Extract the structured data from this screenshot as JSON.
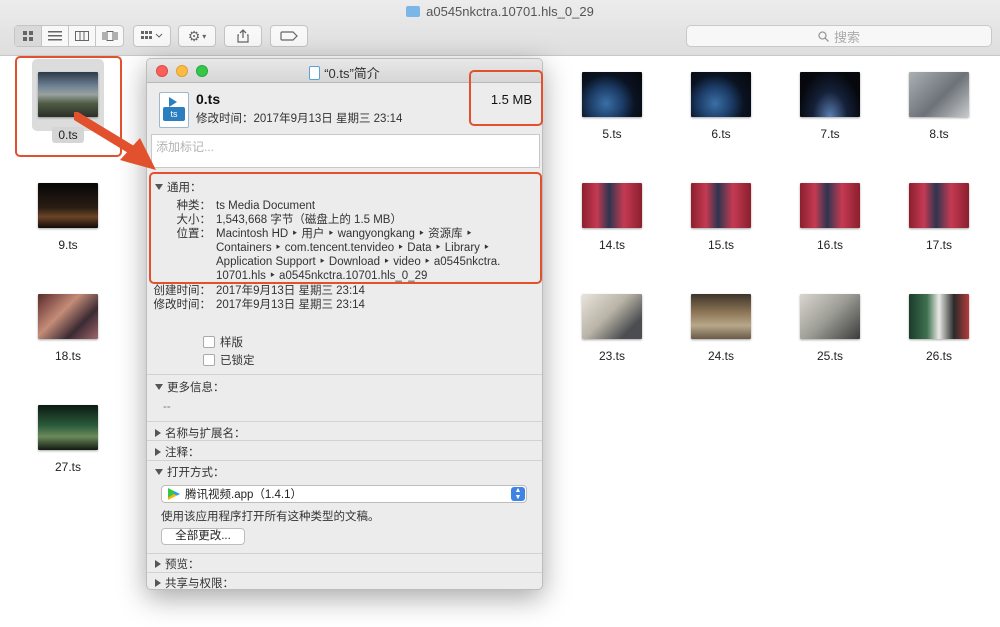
{
  "finder": {
    "window_title": "a0545nkctra.10701.hls_0_29",
    "search_placeholder": "搜索",
    "toolbar": {
      "view_icon": "icon-view-icon",
      "list_view": "list-view-icon",
      "column_view": "column-view-icon",
      "cover_flow": "cover-flow-icon",
      "group_icon": "group-icon",
      "action_icon": "gear-icon",
      "share_icon": "share-icon",
      "tag_icon": "tag-icon"
    },
    "files": [
      {
        "name": "0.ts",
        "thumb": "mountain"
      },
      {
        "name": "5.ts",
        "thumb": "earth"
      },
      {
        "name": "6.ts",
        "thumb": "earth"
      },
      {
        "name": "7.ts",
        "thumb": "space"
      },
      {
        "name": "8.ts",
        "thumb": "gray"
      },
      {
        "name": "9.ts",
        "thumb": "dark"
      },
      {
        "name": "14.ts",
        "thumb": "stage"
      },
      {
        "name": "15.ts",
        "thumb": "stage"
      },
      {
        "name": "16.ts",
        "thumb": "stage"
      },
      {
        "name": "17.ts",
        "thumb": "stage"
      },
      {
        "name": "18.ts",
        "thumb": "crowd"
      },
      {
        "name": "23.ts",
        "thumb": "map"
      },
      {
        "name": "24.ts",
        "thumb": "meet"
      },
      {
        "name": "25.ts",
        "thumb": "paper"
      },
      {
        "name": "26.ts",
        "thumb": "speaker"
      },
      {
        "name": "27.ts",
        "thumb": "forest"
      }
    ]
  },
  "info": {
    "title": "“0.ts”简介",
    "file_name": "0.ts",
    "modified_line": "修改时间：2017年9月13日 星期三 23:14",
    "size": "1.5 MB",
    "tags_placeholder": "添加标记...",
    "general": {
      "header": "通用：",
      "kind_label": "种类：",
      "kind_value": "ts Media Document",
      "size_label": "大小：",
      "size_value": "1,543,668 字节（磁盘上的 1.5 MB）",
      "where_label": "位置：",
      "where_lines": [
        "Macintosh HD ‣ 用户 ‣ wangyongkang ‣ 资源库 ‣",
        "Containers ‣ com.tencent.tenvideo ‣ Data ‣ Library ‣",
        "Application Support ‣ Download ‣ video ‣ a0545nkctra.",
        "10701.hls ‣ a0545nkctra.10701.hls_0_29"
      ],
      "created_label": "创建时间：",
      "created_value": "2017年9月13日 星期三 23:14",
      "modified_label": "修改时间：",
      "modified_value": "2017年9月13日 星期三 23:14",
      "stationery_label": "样版",
      "locked_label": "已锁定"
    },
    "more_info": {
      "header": "更多信息：",
      "value": "--"
    },
    "name_ext": {
      "header": "名称与扩展名："
    },
    "comments": {
      "header": "注释："
    },
    "open_with": {
      "header": "打开方式：",
      "app": "腾讯视频.app（1.4.1）",
      "hint": "使用该应用程序打开所有这种类型的文稿。",
      "change_all": "全部更改..."
    },
    "preview": {
      "header": "预览："
    },
    "sharing": {
      "header": "共享与权限："
    }
  },
  "colors": {
    "annotation": "#e2512d",
    "selection": "#3f84e5"
  }
}
